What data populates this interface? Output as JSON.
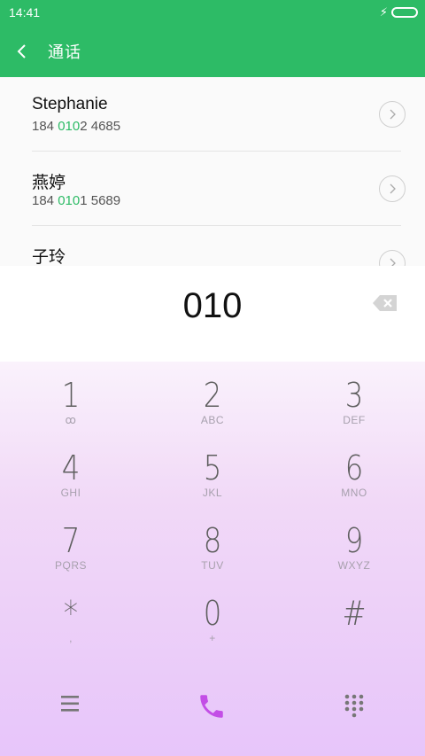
{
  "status_bar": {
    "time": "14:41"
  },
  "header": {
    "title": "通话"
  },
  "contacts": [
    {
      "name": "Stephanie",
      "number_prefix": "184 ",
      "number_match": "010",
      "number_suffix": "2 4685"
    },
    {
      "name": "燕婷",
      "number_prefix": "184 ",
      "number_match": "010",
      "number_suffix": "1 5689"
    },
    {
      "name": "子玲",
      "number_prefix": "",
      "number_match": "",
      "number_suffix": ""
    }
  ],
  "entry": {
    "number": "010"
  },
  "keypad": {
    "keys": [
      {
        "digit": "1",
        "letters": "ꝏ"
      },
      {
        "digit": "2",
        "letters": "ABC"
      },
      {
        "digit": "3",
        "letters": "DEF"
      },
      {
        "digit": "4",
        "letters": "GHI"
      },
      {
        "digit": "5",
        "letters": "JKL"
      },
      {
        "digit": "6",
        "letters": "MNO"
      },
      {
        "digit": "7",
        "letters": "PQRS"
      },
      {
        "digit": "8",
        "letters": "TUV"
      },
      {
        "digit": "9",
        "letters": "WXYZ"
      },
      {
        "digit": "*",
        "letters": ","
      },
      {
        "digit": "0",
        "letters": "+"
      },
      {
        "digit": "#",
        "letters": ""
      }
    ]
  },
  "colors": {
    "accent": "#2dbb66",
    "call": "#c34ee6"
  },
  "icons": [
    "back-icon",
    "bolt-icon",
    "battery-icon",
    "chevron-right-icon",
    "backspace-icon",
    "menu-icon",
    "phone-icon",
    "dialpad-icon"
  ]
}
